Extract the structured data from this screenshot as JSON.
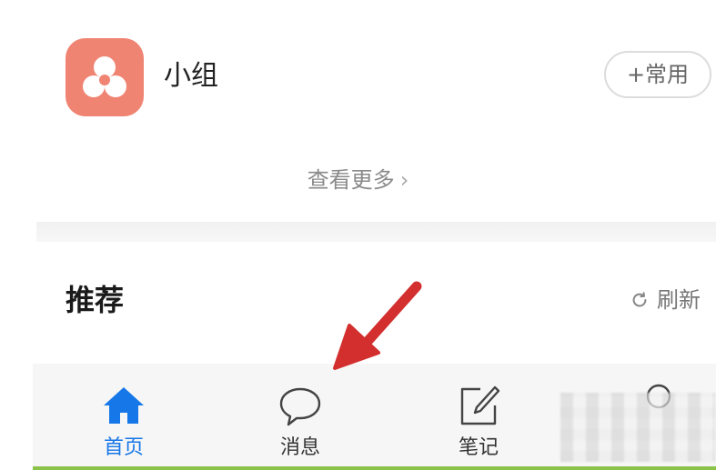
{
  "group": {
    "label": "小组",
    "add_button_label": "+常用"
  },
  "see_more": {
    "label": "查看更多",
    "chevron": "›"
  },
  "recommend": {
    "title": "推荐",
    "refresh_label": "刷新"
  },
  "tabs": [
    {
      "label": "首页",
      "icon": "home-icon",
      "active": true
    },
    {
      "label": "消息",
      "icon": "chat-bubble-icon",
      "active": false
    },
    {
      "label": "笔记",
      "icon": "edit-note-icon",
      "active": false
    },
    {
      "label": "",
      "icon": "profile-icon",
      "active": false
    }
  ],
  "colors": {
    "group_icon": "#f08473",
    "active_tab": "#1677e8",
    "arrow": "#e53935",
    "bottom_line": "#8bc34a"
  }
}
